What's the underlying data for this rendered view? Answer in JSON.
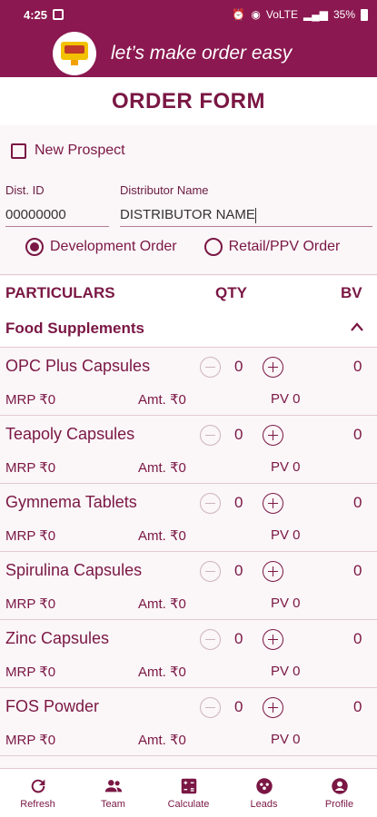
{
  "status_bar": {
    "time": "4:25",
    "right_text": "VoLTE",
    "battery": "35%"
  },
  "header": {
    "tagline": "let’s make order easy"
  },
  "form": {
    "title": "ORDER FORM",
    "new_prospect_label": "New Prospect",
    "new_prospect_checked": false,
    "dist_id_label": "Dist. ID",
    "dist_id_value": "00000000",
    "distributor_name_label": "Distributor Name",
    "distributor_name_value": "DISTRIBUTOR NAME",
    "order_type_options": [
      "Development Order",
      "Retail/PPV Order"
    ],
    "order_type_selected": "Development Order"
  },
  "table": {
    "headers": [
      "PARTICULARS",
      "QTY",
      "BV"
    ],
    "category": "Food Supplements",
    "products": [
      {
        "name": "OPC Plus Capsules",
        "qty": "0",
        "bv": "0",
        "mrp": "MRP ₹0",
        "amt": "Amt. ₹0",
        "pv": "PV 0"
      },
      {
        "name": "Teapoly Capsules",
        "qty": "0",
        "bv": "0",
        "mrp": "MRP ₹0",
        "amt": "Amt. ₹0",
        "pv": "PV 0"
      },
      {
        "name": "Gymnema Tablets",
        "qty": "0",
        "bv": "0",
        "mrp": "MRP ₹0",
        "amt": "Amt. ₹0",
        "pv": "PV 0"
      },
      {
        "name": "Spirulina Capsules",
        "qty": "0",
        "bv": "0",
        "mrp": "MRP ₹0",
        "amt": "Amt. ₹0",
        "pv": "PV 0"
      },
      {
        "name": "Zinc Capsules",
        "qty": "0",
        "bv": "0",
        "mrp": "MRP ₹0",
        "amt": "Amt. ₹0",
        "pv": "PV 0"
      },
      {
        "name": "FOS Powder",
        "qty": "0",
        "bv": "0",
        "mrp": "MRP ₹0",
        "amt": "Amt. ₹0",
        "pv": "PV 0"
      }
    ]
  },
  "nav": {
    "items": [
      {
        "label": "Refresh",
        "icon": "refresh-icon"
      },
      {
        "label": "Team",
        "icon": "team-icon"
      },
      {
        "label": "Calculate",
        "icon": "calculator-icon"
      },
      {
        "label": "Leads",
        "icon": "leads-icon"
      },
      {
        "label": "Profile",
        "icon": "profile-icon"
      }
    ]
  },
  "colors": {
    "brand": "#8b1850",
    "text": "#7a1744",
    "background": "#fbf6f8"
  }
}
